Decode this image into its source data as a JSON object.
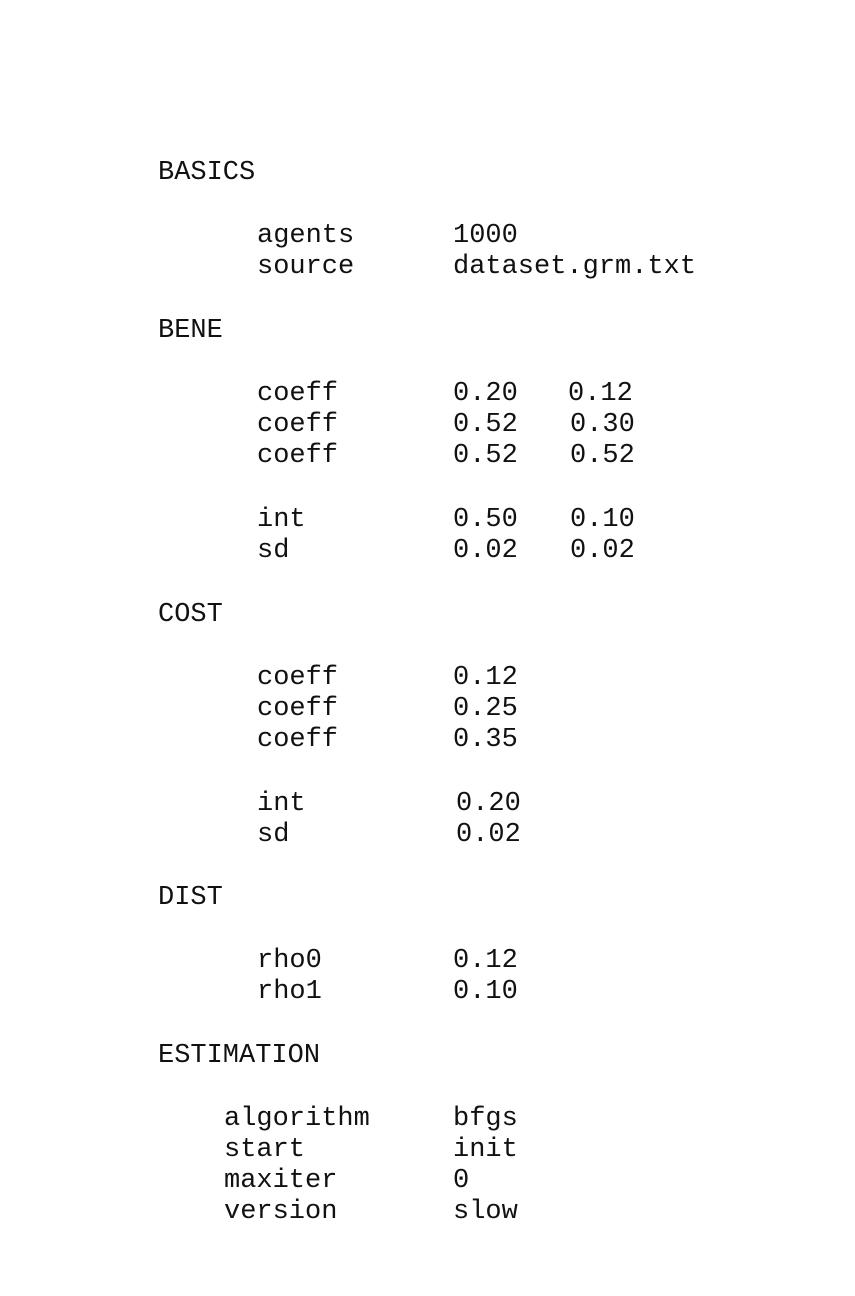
{
  "sections": {
    "basics": {
      "heading": "BASICS",
      "rows": [
        {
          "key": "agents",
          "value": "1000"
        },
        {
          "key": "source",
          "value": "dataset.grm.txt"
        }
      ]
    },
    "bene": {
      "heading": "BENE",
      "rows": [
        {
          "key": "coeff",
          "v1": "0.20",
          "v2": "0.12"
        },
        {
          "key": "coeff",
          "v1": "0.52",
          "v2": "0.30"
        },
        {
          "key": "coeff",
          "v1": "0.52",
          "v2": "0.52"
        },
        {
          "key": "int",
          "v1": "0.50",
          "v2": "0.10"
        },
        {
          "key": "sd",
          "v1": "0.02",
          "v2": "0.02"
        }
      ]
    },
    "cost": {
      "heading": "COST",
      "rows": [
        {
          "key": "coeff",
          "value": "0.12"
        },
        {
          "key": "coeff",
          "value": "0.25"
        },
        {
          "key": "coeff",
          "value": "0.35"
        },
        {
          "key": "int",
          "value": "0.20"
        },
        {
          "key": "sd",
          "value": "0.02"
        }
      ]
    },
    "dist": {
      "heading": "DIST",
      "rows": [
        {
          "key": "rho0",
          "value": "0.12"
        },
        {
          "key": "rho1",
          "value": "0.10"
        }
      ]
    },
    "estimation": {
      "heading": "ESTIMATION",
      "rows": [
        {
          "key": "algorithm",
          "value": "bfgs"
        },
        {
          "key": "start",
          "value": "init"
        },
        {
          "key": "maxiter",
          "value": "0"
        },
        {
          "key": "version",
          "value": "slow"
        }
      ]
    }
  }
}
